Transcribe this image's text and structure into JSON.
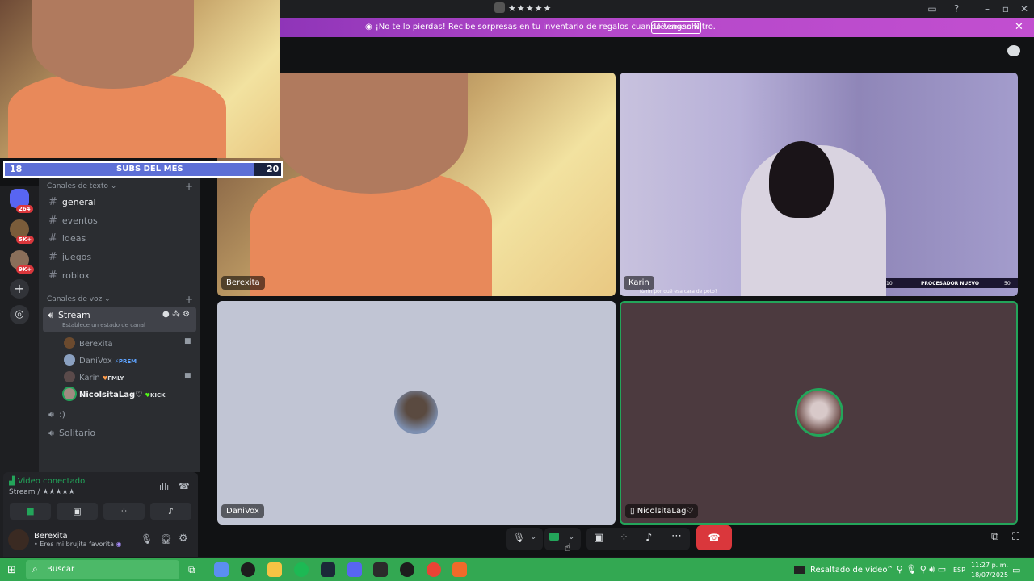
{
  "window": {
    "title": "★★★★★"
  },
  "banner": {
    "text": "¡No te lo pierdas! Recibe sorpresas en tu inventario de regalos cuando tengas Nitro.",
    "button": "Llévame ahí"
  },
  "overlay": {
    "subs_left": "18",
    "subs_label": "SUBS DEL MES",
    "subs_right": "20"
  },
  "servers": {
    "badges": [
      "264",
      "5K+",
      "9K+"
    ]
  },
  "channels": {
    "text_category": "Canales de texto",
    "text": [
      "general",
      "eventos",
      "ideas",
      "juegos",
      "roblox"
    ],
    "voice_category": "Canales de voz",
    "stream": {
      "name": "Stream",
      "status": "Establece un estado de canal"
    },
    "voice_users": [
      {
        "name": "Berexita",
        "tag": ""
      },
      {
        "name": "DaniVox",
        "tag": "PREM"
      },
      {
        "name": "Karin",
        "tag": "FMLY"
      },
      {
        "name": "NicolsitaLag♡",
        "tag": "KICK"
      }
    ],
    "other_voice": [
      ":)",
      "Solitario"
    ]
  },
  "voice_panel": {
    "status": "Video conectado",
    "channel": "Stream / ★★★★★"
  },
  "user_panel": {
    "name": "Berexita",
    "status": "Eres mi brujita favorita"
  },
  "tiles": [
    {
      "name": "Berexita"
    },
    {
      "name": "Karin",
      "chat": "Karin por qué esa cara de poto?",
      "overlay_left": "10",
      "overlay_label": "PROCESADOR NUEVO",
      "overlay_right": "50"
    },
    {
      "name": "DaniVox"
    },
    {
      "name": "NicolsitaLag♡"
    }
  ],
  "taskbar": {
    "search": "Buscar",
    "notification": "Resaltado de vídeo",
    "lang": "ESP",
    "time": "11:27 p. m.",
    "date": "18/07/2025"
  },
  "colors": {
    "banner": "#b347c9",
    "taskbar": "#33a852",
    "hangup": "#da373c",
    "connected": "#23a55a"
  }
}
